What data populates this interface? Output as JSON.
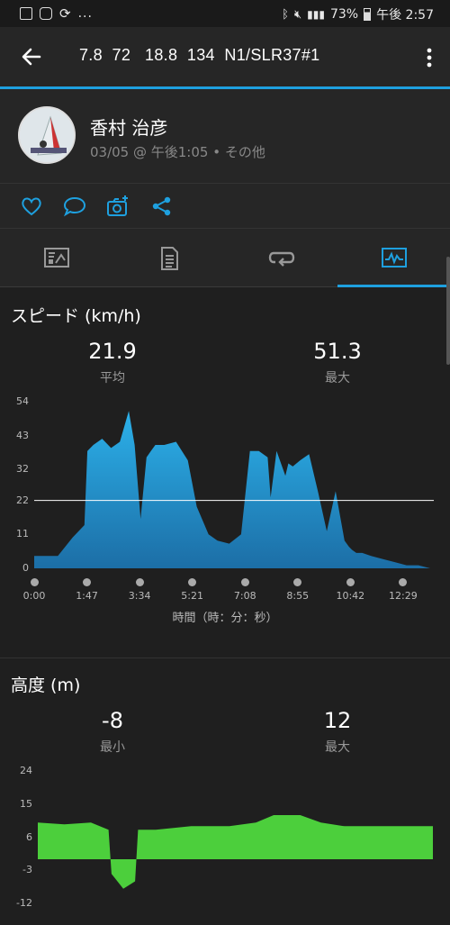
{
  "status_bar": {
    "left_icons": [
      "image-icon",
      "instagram-icon",
      "sync-icon",
      "more-dots"
    ],
    "battery": "73%",
    "time": "午後 2:57"
  },
  "header": {
    "title": "7.8  72   18.8  134  N1/SLR37#1"
  },
  "profile": {
    "name": "香村 治彦",
    "meta": "03/05 @ 午後1:05 • その他"
  },
  "actions": [
    "heart-icon",
    "comment-icon",
    "add-photo-icon",
    "share-icon"
  ],
  "tabs": [
    "summary-tab",
    "details-tab",
    "laps-tab",
    "charts-tab"
  ],
  "speed": {
    "title": "スピード (km/h)",
    "avg_value": "21.9",
    "avg_label": "平均",
    "max_value": "51.3",
    "max_label": "最大",
    "x_axis_title": "時間（時：分：秒）"
  },
  "altitude": {
    "title": "高度 (m)",
    "min_value": "-8",
    "min_label": "最小",
    "max_value": "12",
    "max_label": "最大"
  },
  "colors": {
    "accent": "#1ea0df",
    "speed_fill_top": "#29a9e1",
    "speed_fill_bottom": "#1b6fa5",
    "altitude_fill": "#4ccf3c"
  },
  "chart_data": [
    {
      "type": "area",
      "title": "スピード (km/h)",
      "xlabel": "時間（時：分：秒）",
      "ylabel": "",
      "y_ticks": [
        "54",
        "43",
        "32",
        "22",
        "11",
        "0"
      ],
      "x_ticks": [
        "0:00",
        "1:47",
        "3:34",
        "5:21",
        "7:08",
        "8:55",
        "10:42",
        "12:29"
      ],
      "ylim": [
        0,
        54
      ],
      "average_line": 22,
      "x_minutes": [
        0,
        0.8,
        1.3,
        1.7,
        1.8,
        2.0,
        2.3,
        2.6,
        2.9,
        3.2,
        3.4,
        3.6,
        3.8,
        3.95,
        4.1,
        4.4,
        4.8,
        5.2,
        5.5,
        5.9,
        6.2,
        6.6,
        7.0,
        7.3,
        7.6,
        7.9,
        8.0,
        8.2,
        8.5,
        8.6,
        8.75,
        9.0,
        9.3,
        9.6,
        9.9,
        10.2,
        10.5,
        10.65,
        10.75,
        10.9,
        11.1,
        11.4,
        11.8,
        12.2,
        12.6,
        13.0,
        13.4
      ],
      "values": [
        4,
        4,
        10,
        14,
        38,
        40,
        42,
        39,
        41,
        51,
        40,
        16,
        36,
        38,
        40,
        40,
        41,
        35,
        20,
        11,
        9,
        8,
        11,
        38,
        38,
        36,
        23,
        38,
        30,
        34,
        33,
        35,
        37,
        25,
        12,
        25,
        9,
        7,
        6,
        5,
        5,
        4,
        3,
        2,
        1,
        1,
        0
      ]
    },
    {
      "type": "area",
      "title": "高度 (m)",
      "xlabel": "",
      "ylabel": "",
      "y_ticks": [
        "24",
        "15",
        "6",
        "-3",
        "-12"
      ],
      "ylim": [
        -12,
        24
      ],
      "x_minutes": [
        0,
        0.9,
        1.8,
        2.4,
        2.5,
        2.9,
        3.3,
        3.4,
        4.0,
        5.2,
        6.5,
        7.4,
        8.0,
        8.9,
        9.6,
        10.4,
        11.4,
        13.4
      ],
      "values": [
        10,
        9.5,
        10,
        8,
        -4,
        -8,
        -6,
        8,
        8,
        9,
        9,
        10,
        12,
        12,
        10,
        9,
        9,
        9
      ]
    }
  ]
}
